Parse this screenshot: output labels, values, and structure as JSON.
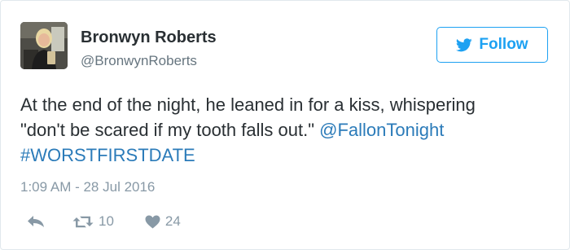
{
  "author": {
    "name": "Bronwyn Roberts",
    "handle": "@BronwynRoberts"
  },
  "follow_button": {
    "label": "Follow",
    "icon": "twitter-bird-icon"
  },
  "tweet": {
    "line1": "At the end of the night, he leaned in for a kiss, whispering",
    "line2_text": "\"don't be scared if my tooth falls out.\"",
    "mention": "@FallonTonight",
    "hashtag": "#WORSTFIRSTDATE",
    "timestamp": "1:09 AM - 28 Jul 2016"
  },
  "actions": {
    "reply_icon": "reply-icon",
    "retweet_icon": "retweet-icon",
    "retweet_count": "10",
    "like_icon": "heart-icon",
    "like_count": "24"
  },
  "colors": {
    "accent": "#1da1f2",
    "link": "#2b7bb9",
    "text": "#292f33",
    "secondary": "#66757f",
    "muted": "#8899a6",
    "border": "#e1e8ed"
  }
}
